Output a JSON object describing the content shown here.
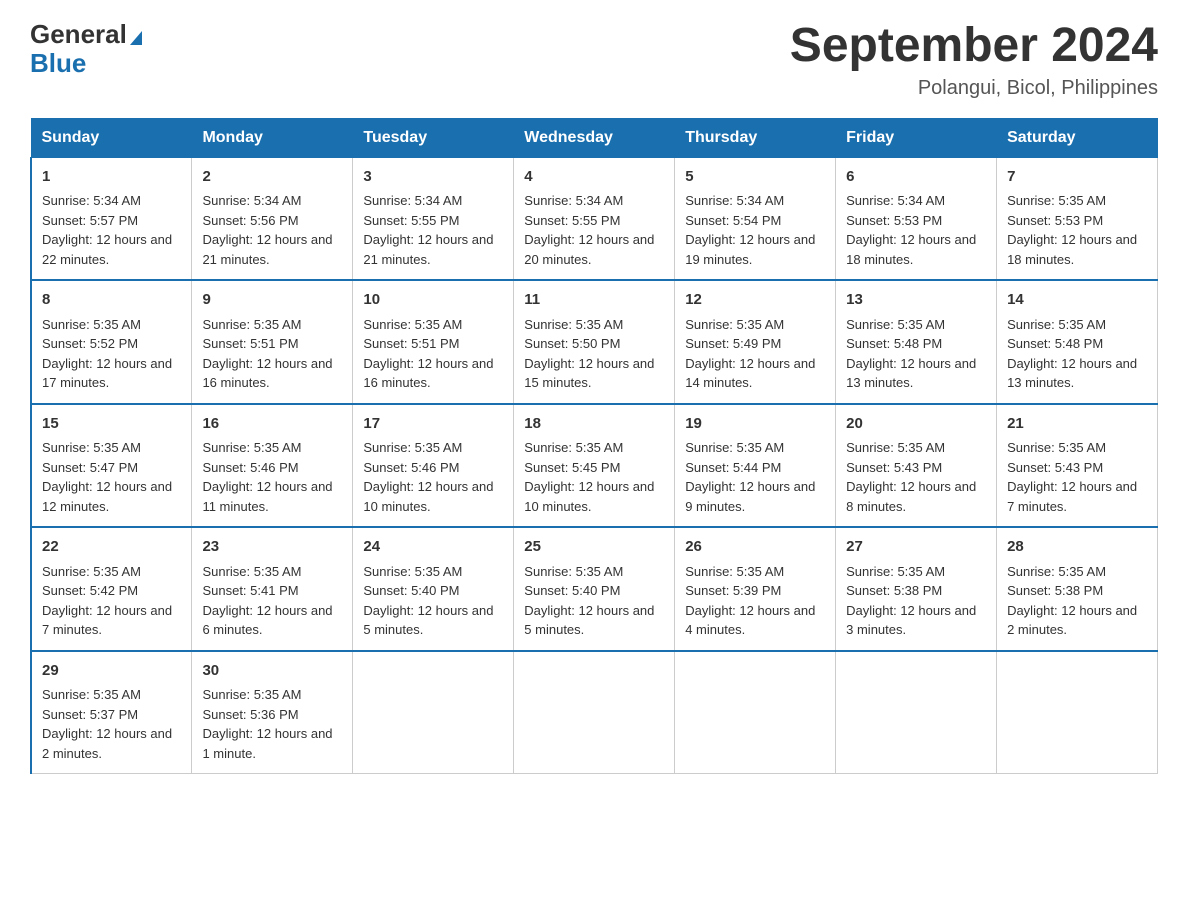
{
  "logo": {
    "text_general": "General",
    "text_blue": "Blue"
  },
  "header": {
    "title": "September 2024",
    "subtitle": "Polangui, Bicol, Philippines"
  },
  "days_of_week": [
    "Sunday",
    "Monday",
    "Tuesday",
    "Wednesday",
    "Thursday",
    "Friday",
    "Saturday"
  ],
  "weeks": [
    [
      {
        "day": "1",
        "sunrise": "5:34 AM",
        "sunset": "5:57 PM",
        "daylight": "12 hours and 22 minutes."
      },
      {
        "day": "2",
        "sunrise": "5:34 AM",
        "sunset": "5:56 PM",
        "daylight": "12 hours and 21 minutes."
      },
      {
        "day": "3",
        "sunrise": "5:34 AM",
        "sunset": "5:55 PM",
        "daylight": "12 hours and 21 minutes."
      },
      {
        "day": "4",
        "sunrise": "5:34 AM",
        "sunset": "5:55 PM",
        "daylight": "12 hours and 20 minutes."
      },
      {
        "day": "5",
        "sunrise": "5:34 AM",
        "sunset": "5:54 PM",
        "daylight": "12 hours and 19 minutes."
      },
      {
        "day": "6",
        "sunrise": "5:34 AM",
        "sunset": "5:53 PM",
        "daylight": "12 hours and 18 minutes."
      },
      {
        "day": "7",
        "sunrise": "5:35 AM",
        "sunset": "5:53 PM",
        "daylight": "12 hours and 18 minutes."
      }
    ],
    [
      {
        "day": "8",
        "sunrise": "5:35 AM",
        "sunset": "5:52 PM",
        "daylight": "12 hours and 17 minutes."
      },
      {
        "day": "9",
        "sunrise": "5:35 AM",
        "sunset": "5:51 PM",
        "daylight": "12 hours and 16 minutes."
      },
      {
        "day": "10",
        "sunrise": "5:35 AM",
        "sunset": "5:51 PM",
        "daylight": "12 hours and 16 minutes."
      },
      {
        "day": "11",
        "sunrise": "5:35 AM",
        "sunset": "5:50 PM",
        "daylight": "12 hours and 15 minutes."
      },
      {
        "day": "12",
        "sunrise": "5:35 AM",
        "sunset": "5:49 PM",
        "daylight": "12 hours and 14 minutes."
      },
      {
        "day": "13",
        "sunrise": "5:35 AM",
        "sunset": "5:48 PM",
        "daylight": "12 hours and 13 minutes."
      },
      {
        "day": "14",
        "sunrise": "5:35 AM",
        "sunset": "5:48 PM",
        "daylight": "12 hours and 13 minutes."
      }
    ],
    [
      {
        "day": "15",
        "sunrise": "5:35 AM",
        "sunset": "5:47 PM",
        "daylight": "12 hours and 12 minutes."
      },
      {
        "day": "16",
        "sunrise": "5:35 AM",
        "sunset": "5:46 PM",
        "daylight": "12 hours and 11 minutes."
      },
      {
        "day": "17",
        "sunrise": "5:35 AM",
        "sunset": "5:46 PM",
        "daylight": "12 hours and 10 minutes."
      },
      {
        "day": "18",
        "sunrise": "5:35 AM",
        "sunset": "5:45 PM",
        "daylight": "12 hours and 10 minutes."
      },
      {
        "day": "19",
        "sunrise": "5:35 AM",
        "sunset": "5:44 PM",
        "daylight": "12 hours and 9 minutes."
      },
      {
        "day": "20",
        "sunrise": "5:35 AM",
        "sunset": "5:43 PM",
        "daylight": "12 hours and 8 minutes."
      },
      {
        "day": "21",
        "sunrise": "5:35 AM",
        "sunset": "5:43 PM",
        "daylight": "12 hours and 7 minutes."
      }
    ],
    [
      {
        "day": "22",
        "sunrise": "5:35 AM",
        "sunset": "5:42 PM",
        "daylight": "12 hours and 7 minutes."
      },
      {
        "day": "23",
        "sunrise": "5:35 AM",
        "sunset": "5:41 PM",
        "daylight": "12 hours and 6 minutes."
      },
      {
        "day": "24",
        "sunrise": "5:35 AM",
        "sunset": "5:40 PM",
        "daylight": "12 hours and 5 minutes."
      },
      {
        "day": "25",
        "sunrise": "5:35 AM",
        "sunset": "5:40 PM",
        "daylight": "12 hours and 5 minutes."
      },
      {
        "day": "26",
        "sunrise": "5:35 AM",
        "sunset": "5:39 PM",
        "daylight": "12 hours and 4 minutes."
      },
      {
        "day": "27",
        "sunrise": "5:35 AM",
        "sunset": "5:38 PM",
        "daylight": "12 hours and 3 minutes."
      },
      {
        "day": "28",
        "sunrise": "5:35 AM",
        "sunset": "5:38 PM",
        "daylight": "12 hours and 2 minutes."
      }
    ],
    [
      {
        "day": "29",
        "sunrise": "5:35 AM",
        "sunset": "5:37 PM",
        "daylight": "12 hours and 2 minutes."
      },
      {
        "day": "30",
        "sunrise": "5:35 AM",
        "sunset": "5:36 PM",
        "daylight": "12 hours and 1 minute."
      },
      null,
      null,
      null,
      null,
      null
    ]
  ]
}
